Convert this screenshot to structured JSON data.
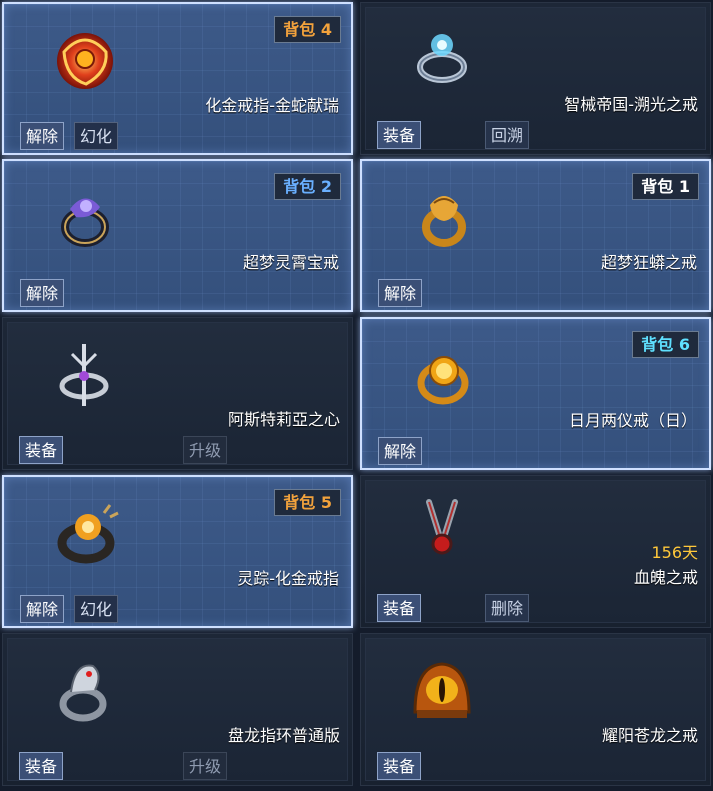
{
  "cards": [
    {
      "name": "化金戒指-金蛇献瑞",
      "bag": "背包 4",
      "bag_color": "#f2a23c",
      "btn1": "解除",
      "btn2": "幻化",
      "icon": "gold-snake-ring-icon",
      "lit": true
    },
    {
      "name": "智械帝国-溯光之戒",
      "btn1": "装备",
      "btn2": "回溯",
      "icon": "light-tracing-ring-icon",
      "lit": false
    },
    {
      "name": "超梦灵霄宝戒",
      "bag": "背包 2",
      "bag_color": "#6ab0ff",
      "btn1": "解除",
      "icon": "purple-gem-ring-icon",
      "lit": true
    },
    {
      "name": "超梦狂蟒之戒",
      "bag": "背包 1",
      "bag_color": "#ffffff",
      "btn1": "解除",
      "icon": "golden-python-ring-icon",
      "lit": true
    },
    {
      "name": "阿斯特莉亞之心",
      "btn1": "装备",
      "btn2": "升级",
      "icon": "trident-ring-icon",
      "lit": false
    },
    {
      "name": "日月两仪戒（日）",
      "bag": "背包 6",
      "bag_color": "#5fe0ff",
      "btn1": "解除",
      "icon": "sun-gem-ring-icon",
      "lit": true
    },
    {
      "name": "灵踪-化金戒指",
      "bag": "背包 5",
      "bag_color": "#f2a23c",
      "btn1": "解除",
      "btn2": "幻化",
      "icon": "orb-ring-icon",
      "lit": true
    },
    {
      "name": "血魄之戒",
      "duration": "156天",
      "btn1": "装备",
      "btn2": "删除",
      "icon": "blood-ring-icon",
      "lit": false
    },
    {
      "name": "盘龙指环普通版",
      "btn1": "装备",
      "btn2": "升级",
      "icon": "coiled-dragon-ring-icon",
      "lit": false
    },
    {
      "name": "耀阳苍龙之戒",
      "btn1": "装备",
      "icon": "dragon-eye-ring-icon",
      "lit": false
    }
  ]
}
